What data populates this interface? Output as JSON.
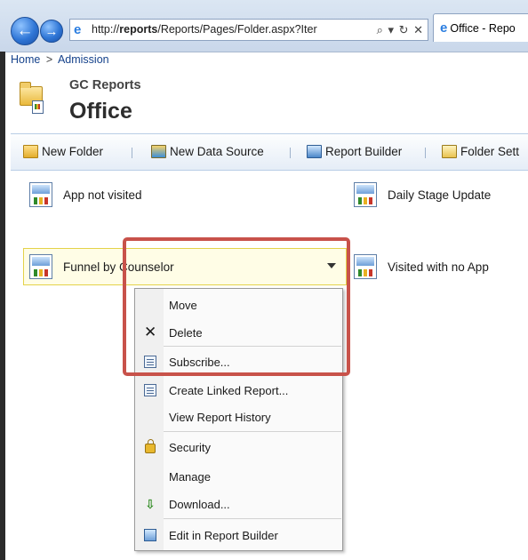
{
  "browser": {
    "url_prefix": "http://",
    "url_host": "reports",
    "url_rest": "/Reports/Pages/Folder.aspx?Iter",
    "url_controls": "⌕ ▾ ↻ ✕",
    "tab_title": "Office - Repo"
  },
  "breadcrumb": {
    "home": "Home",
    "separator": ">",
    "current": "Admission"
  },
  "header": {
    "site_title": "GC Reports",
    "page_title": "Office"
  },
  "toolbar": {
    "new_folder": "New Folder",
    "new_data_source": "New Data Source",
    "report_builder": "Report Builder",
    "folder_settings": "Folder Sett"
  },
  "reports": [
    {
      "label": "App not visited"
    },
    {
      "label": "Daily Stage Update"
    },
    {
      "label": "Funnel by Counselor"
    },
    {
      "label": "Visited with no App"
    }
  ],
  "context_menu": {
    "items": [
      {
        "label": "Move",
        "icon": ""
      },
      {
        "label": "Delete",
        "icon": "delete-icon"
      },
      {
        "label": "Subscribe...",
        "icon": "subscribe-icon"
      },
      {
        "label": "Create Linked Report...",
        "icon": "linked-report-icon"
      },
      {
        "label": "View Report History",
        "icon": ""
      },
      {
        "label": "Security",
        "icon": "lock-icon"
      },
      {
        "label": "Manage",
        "icon": ""
      },
      {
        "label": "Download...",
        "icon": "download-icon"
      },
      {
        "label": "Edit in Report Builder",
        "icon": "report-builder-icon"
      }
    ]
  },
  "colors": {
    "highlight_border": "#c8524a",
    "hover_background": "#fffde6",
    "link": "#15428b"
  }
}
